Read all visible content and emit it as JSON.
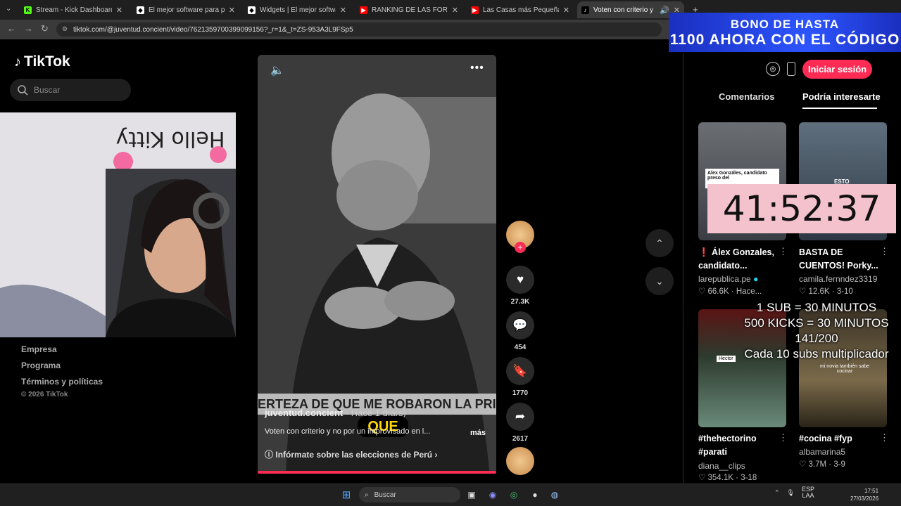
{
  "browser": {
    "tabs": [
      {
        "title": "Stream - Kick Dashboard",
        "icon": "kick-icon",
        "color": "#53fc18"
      },
      {
        "title": "El mejor software para potenci",
        "icon": "streamelements-icon",
        "color": "#ffffff"
      },
      {
        "title": "Widgets | El mejor software par",
        "icon": "streamelements-icon",
        "color": "#ffffff"
      },
      {
        "title": "RANKING DE LAS FORTUNAS D",
        "icon": "youtube-icon",
        "color": "#ff0000"
      },
      {
        "title": "Las Casas más Pequeñas del M",
        "icon": "youtube-icon",
        "color": "#ff0000"
      },
      {
        "title": "Voten con criterio y no por",
        "icon": "tiktok-icon",
        "color": "#ffffff"
      }
    ],
    "url": "tiktok.com/@juventud.concient/video/7621359700399099156?_r=1&_t=ZS-953A3L9FSp5"
  },
  "overlay": {
    "bono_line1": "BONO DE HASTA",
    "bono_line2": "1100 AHORA CON EL CÓDIGO",
    "timer": "41:52:37",
    "sub_lines": [
      "1 SUB     = 30 MINUTOS",
      "500 KICKS = 30 MINUTOS",
      "141/200",
      "Cada 10 subs multiplicador"
    ]
  },
  "tiktok": {
    "logo": "TikTok",
    "search_placeholder": "Buscar",
    "footer": [
      "Empresa",
      "Programa",
      "Términos y políticas"
    ],
    "copyright": "© 2026 TikTok",
    "login": "Iniciar sesión",
    "tabs": {
      "comments": "Comentarios",
      "related": "Podría interesarte"
    }
  },
  "video": {
    "caption_strip": "ERTEZA DE QUE ME ROBARON LA PRIM",
    "overlay_word": "QUE",
    "author": "juventud.concient",
    "time": "· Hace 1 día(s)",
    "description": "Voten con criterio y no por un improvisado en l...",
    "more": "más",
    "elections_link": "Infórmate sobre las elecciones de Perú",
    "likes": "27.3K",
    "comments": "454",
    "saves": "1770",
    "shares": "2617"
  },
  "related": [
    {
      "title": "❗ Álex Gonzales, candidato...",
      "author": "larepublica.pe",
      "verified": true,
      "likes": "66.6K",
      "when": "Hace...",
      "thumb_text": "Alex Gonzáles, candidato preso del"
    },
    {
      "title": "BASTA DE CUENTOS! Porky...",
      "author": "camila.fernndez3319",
      "likes": "12.6K",
      "when": "3-10",
      "thumb_text": "ESTO"
    },
    {
      "title": "#thehectorino #parati",
      "author": "diana__clips",
      "likes": "354.1K",
      "when": "3-18",
      "thumb_text": "Hector"
    },
    {
      "title": "#cocina #fyp",
      "author": "albamarina5",
      "likes": "3.7M",
      "when": "3-9",
      "thumb_text": "mi novia también sabe cocinar"
    }
  ],
  "taskbar": {
    "search": "Buscar",
    "lang": "ESP",
    "lang2": "LAA",
    "time": "17:51",
    "date": "27/03/2026"
  }
}
